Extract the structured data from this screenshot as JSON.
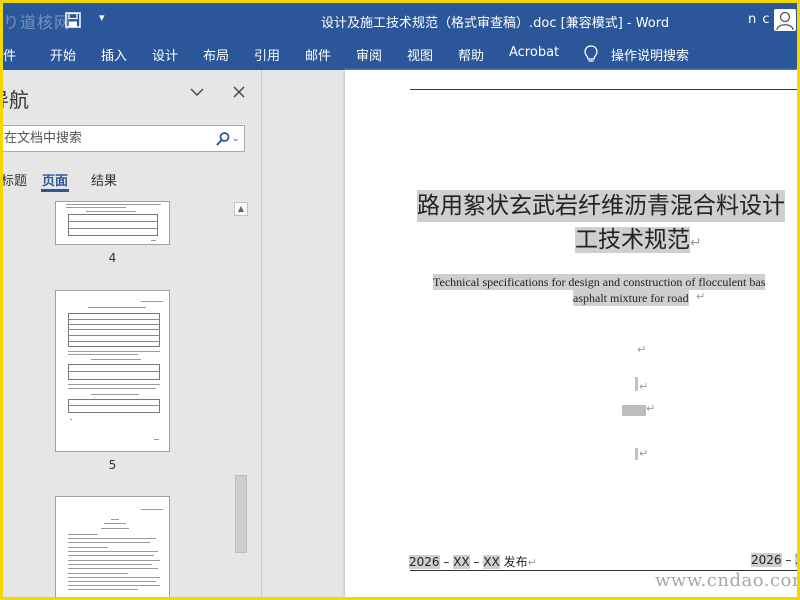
{
  "titlebar": {
    "logo_watermark": "り道核网",
    "doc_title": "设计及施工技术规范（格式审查稿）.doc [兼容模式]  -  Word",
    "user_initials": "n c"
  },
  "ribbon": {
    "tabs": [
      "文件",
      "开始",
      "插入",
      "设计",
      "布局",
      "引用",
      "邮件",
      "审阅",
      "视图",
      "帮助",
      "Acrobat"
    ],
    "tell_me": "操作说明搜索"
  },
  "nav": {
    "title": "导航",
    "search_placeholder": "在文档中搜索",
    "subtabs": [
      "标题",
      "页面",
      "结果"
    ],
    "active_subtab": "页面",
    "page_numbers": [
      "4",
      "5"
    ]
  },
  "document": {
    "title_cn_line1": "路用絮状玄武岩纤维沥青混合料设计",
    "title_cn_line2": "工技术规范",
    "title_en_line1": "Technical specifications for design and construction of flocculent bas",
    "title_en_line2": "asphalt mixture for road",
    "pub_date_year": "2026",
    "pub_date_month": "XX",
    "pub_date_day": "XX",
    "pub_suffix": "发布",
    "impl_date_year": "2026",
    "impl_date_rest": "X",
    "dash": "–",
    "para_mark": "↵"
  },
  "watermark": "www.cndao.com",
  "colors": {
    "ribbon_blue": "#2b579a",
    "frame_yellow": "#f0d800",
    "highlight_grey": "#cfcfcf"
  }
}
